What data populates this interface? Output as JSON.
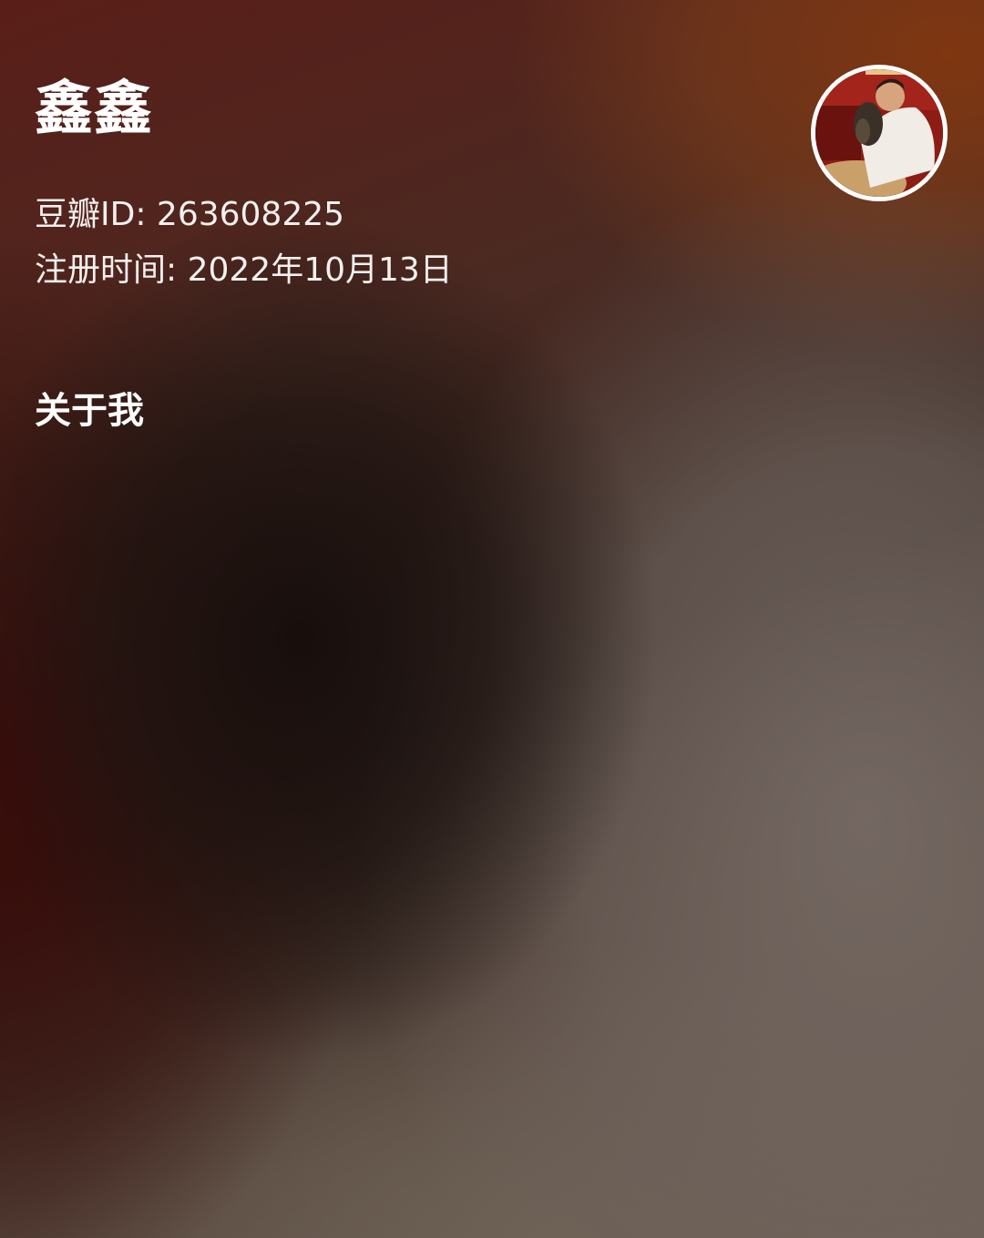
{
  "profile": {
    "nickname": "鑫鑫",
    "douban_id_line": "豆瓣ID: 263608225",
    "register_line": "注册时间: 2022年10月13日",
    "avatar_icon": "user-avatar-photo"
  },
  "about": {
    "title": "关于我"
  }
}
